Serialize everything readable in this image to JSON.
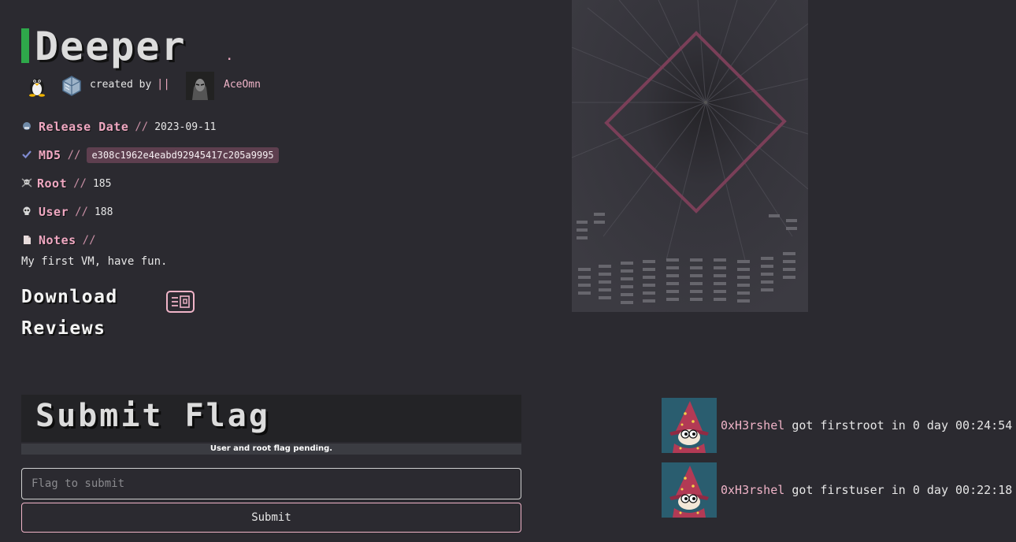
{
  "machine": {
    "name": "Deeper",
    "title_suffix": "."
  },
  "creator": {
    "created_by_label": "created by",
    "separator": "||",
    "author_name": "AceOmn"
  },
  "meta": {
    "release_date_label": "Release Date",
    "release_date_value": "2023-09-11",
    "md5_label": "MD5",
    "md5_value": "e308c1962e4eabd92945417c205a9995",
    "root_label": "Root",
    "root_value": "185",
    "user_label": "User",
    "user_value": "188",
    "notes_label": "Notes",
    "notes_value": "My first VM, have fun.",
    "slashes": "//"
  },
  "sections": {
    "download_label": "Download",
    "reviews_label": "Reviews"
  },
  "flag": {
    "title": "Submit Flag",
    "status": "User and root flag pending.",
    "input_placeholder": "Flag to submit",
    "submit_label": "Submit"
  },
  "activity": [
    {
      "user": "0xH3rshel",
      "text": "got firstroot in 0 day 00:24:54"
    },
    {
      "user": "0xH3rshel",
      "text": "got firstuser in 0 day 00:22:18"
    }
  ],
  "colors": {
    "background": "#2b2a30",
    "accent_pink": "#f0b4c8",
    "accent_green": "#2ea84a",
    "md5_badge": "#5e3f4f"
  },
  "icons": {
    "os": "linux-tux-icon",
    "platform": "virtualbox-icon",
    "release": "calendar-icon",
    "md5": "checkmark-icon",
    "root": "skull-crossbones-icon",
    "user": "skull-icon",
    "notes": "note-icon",
    "download": "download-icon"
  }
}
